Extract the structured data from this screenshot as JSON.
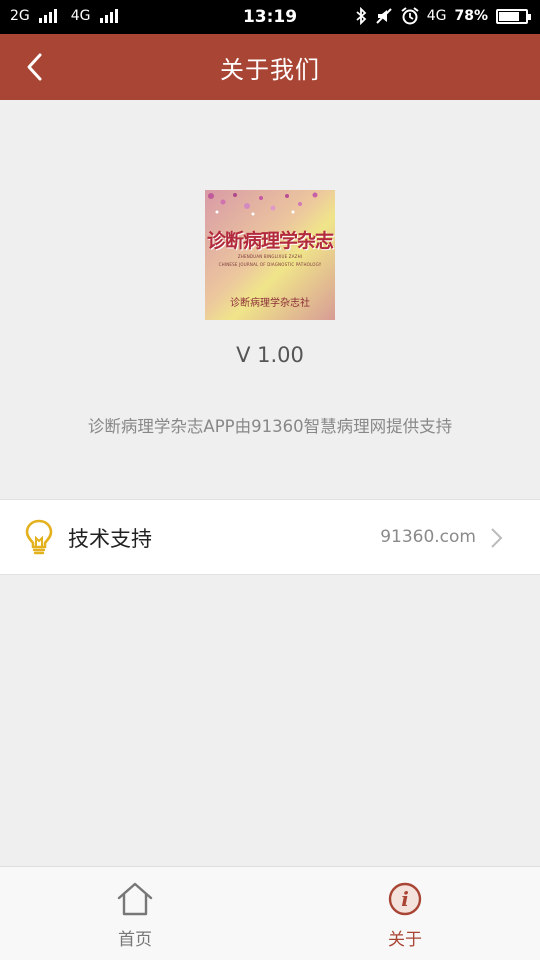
{
  "status_bar": {
    "network1": "2G",
    "network2": "4G",
    "time": "13:19",
    "network3": "4G",
    "battery": "78%",
    "battery_level": 0.78
  },
  "header": {
    "title": "关于我们",
    "back_icon": "chevron-left-icon"
  },
  "logo": {
    "title": "诊断病理学杂志",
    "sub1": "ZHENDUAN BINGLIXUE ZAZHI",
    "sub2": "CHINESE JOURNAL OF DIAGNOSTIC PATHOLOGY",
    "publisher": "诊断病理学杂志社"
  },
  "version": "V 1.00",
  "description": "诊断病理学杂志APP由91360智慧病理网提供支持",
  "support": {
    "label": "技术支持",
    "link": "91360.com",
    "icon": "lightbulb-icon"
  },
  "tabs": {
    "home": {
      "label": "首页",
      "icon": "home-icon"
    },
    "about": {
      "label": "关于",
      "icon": "info-icon",
      "active": true
    }
  },
  "colors": {
    "accent": "#a94535",
    "bulb": "#e4b11e"
  }
}
